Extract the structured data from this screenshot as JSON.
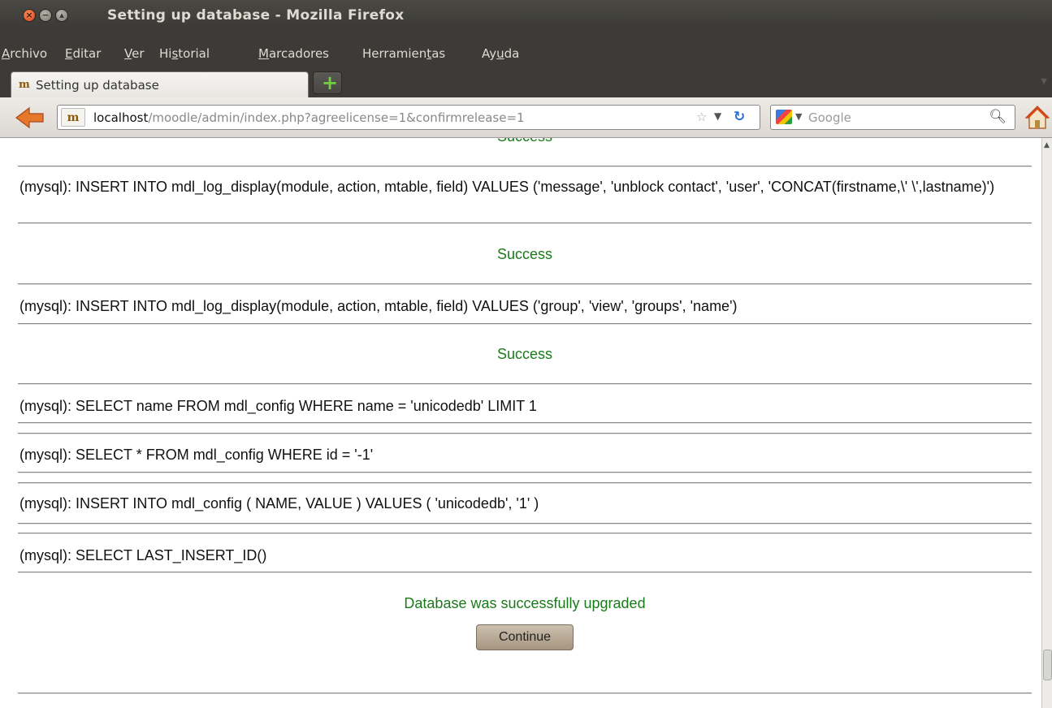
{
  "window": {
    "title": "Setting up database - Mozilla Firefox"
  },
  "menubar": {
    "items": [
      {
        "accel": "A",
        "rest": "rchivo"
      },
      {
        "accel": "E",
        "rest": "ditar"
      },
      {
        "accel": "V",
        "rest": "er"
      },
      {
        "pre": "Hi",
        "accel": "s",
        "rest": "torial"
      },
      {
        "accel": "M",
        "rest": "arcadores"
      },
      {
        "pre": "Herramien",
        "accel": "t",
        "rest": "as"
      },
      {
        "pre": "Ay",
        "accel": "u",
        "rest": "da"
      }
    ]
  },
  "tab": {
    "label": "Setting up database"
  },
  "navbar": {
    "url_host": "localhost",
    "url_path": "/moodle/admin/index.php?agreelicense=1&confirmrelease=1",
    "search_placeholder": "Google"
  },
  "content": {
    "partial_top": "Success",
    "entries": [
      {
        "sql": "(mysql): INSERT INTO mdl_log_display(module, action, mtable, field) VALUES ('message', 'unblock contact', 'user', 'CONCAT(firstname,\\' \\',lastname)')",
        "result": "Success"
      },
      {
        "sql": "(mysql): INSERT INTO mdl_log_display(module, action, mtable, field) VALUES ('group', 'view', 'groups', 'name')",
        "result": "Success"
      },
      {
        "sql": "(mysql): SELECT name FROM mdl_config WHERE name = 'unicodedb' LIMIT 1"
      },
      {
        "sql": "(mysql): SELECT * FROM mdl_config WHERE id = '-1'"
      },
      {
        "sql": "(mysql): INSERT INTO mdl_config ( NAME, VALUE ) VALUES ( 'unicodedb', '1' )"
      },
      {
        "sql": "(mysql): SELECT LAST_INSERT_ID()"
      }
    ],
    "final_message": "Database was successfully upgraded",
    "continue_label": "Continue"
  },
  "colors": {
    "success": "#1a7a1a",
    "titlebar": "#3c3b37"
  }
}
